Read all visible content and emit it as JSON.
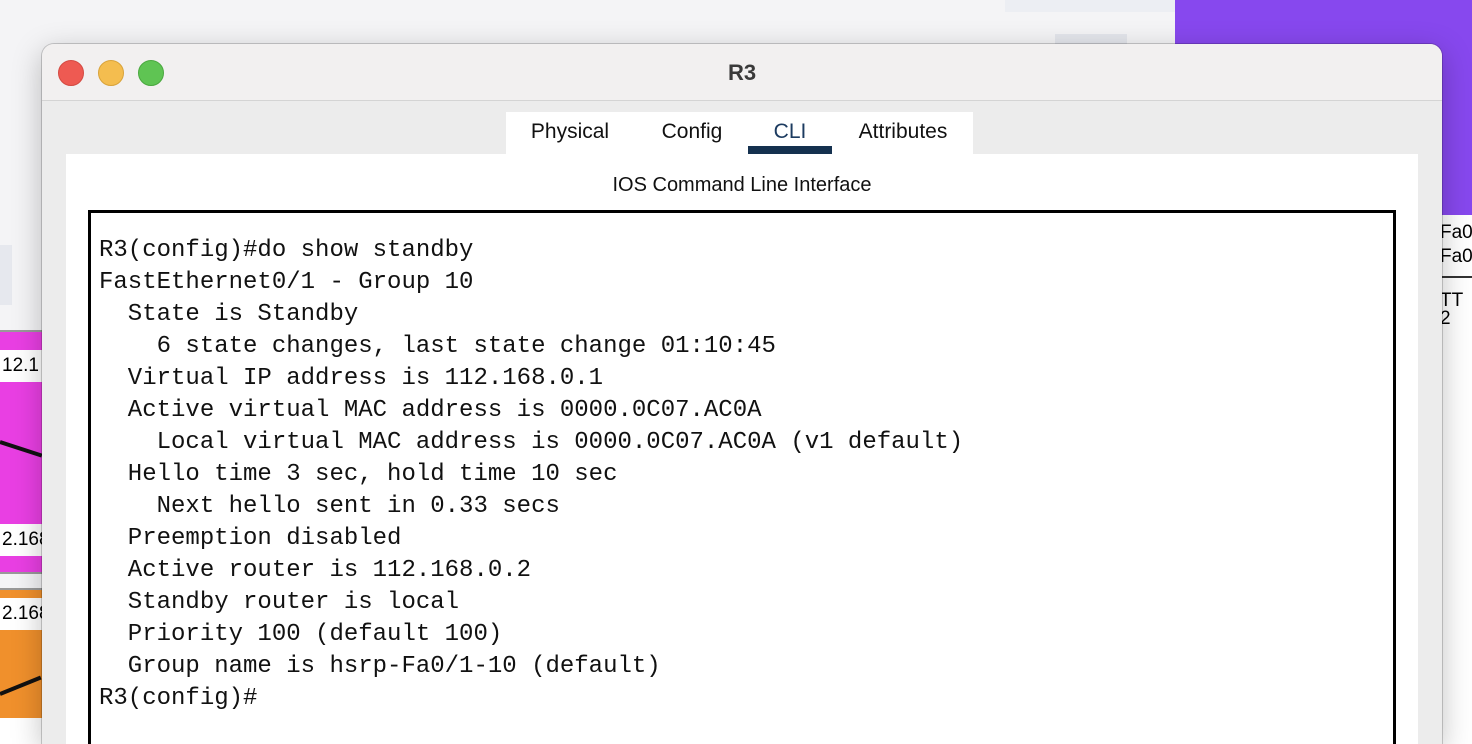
{
  "window": {
    "title": "R3",
    "buttons": {
      "close": "close",
      "minimize": "minimize",
      "zoom": "zoom"
    }
  },
  "tabs": [
    {
      "label": "Physical",
      "active": false
    },
    {
      "label": "Config",
      "active": false
    },
    {
      "label": "CLI",
      "active": true
    },
    {
      "label": "Attributes",
      "active": false
    }
  ],
  "cli": {
    "heading": "IOS Command Line Interface",
    "lines": [
      "R3(config)#do show standby",
      "FastEthernet0/1 - Group 10",
      "  State is Standby",
      "    6 state changes, last state change 01:10:45",
      "  Virtual IP address is 112.168.0.1",
      "  Active virtual MAC address is 0000.0C07.AC0A",
      "    Local virtual MAC address is 0000.0C07.AC0A (v1 default)",
      "  Hello time 3 sec, hold time 10 sec",
      "    Next hello sent in 0.33 secs",
      "  Preemption disabled",
      "  Active router is 112.168.0.2",
      "  Standby router is local",
      "  Priority 100 (default 100)",
      "  Group name is hsrp-Fa0/1-10 (default)",
      "R3(config)#"
    ]
  },
  "background": {
    "left_labels": [
      "12.1",
      "2.168",
      "2.168"
    ],
    "right_labels": [
      "Fa0",
      "Fa0",
      "TT",
      "2"
    ]
  },
  "colors": {
    "active_tab_underline": "#15314f",
    "close": "#ee5a52",
    "minimize": "#f4bd4f",
    "zoom": "#5fc453"
  }
}
